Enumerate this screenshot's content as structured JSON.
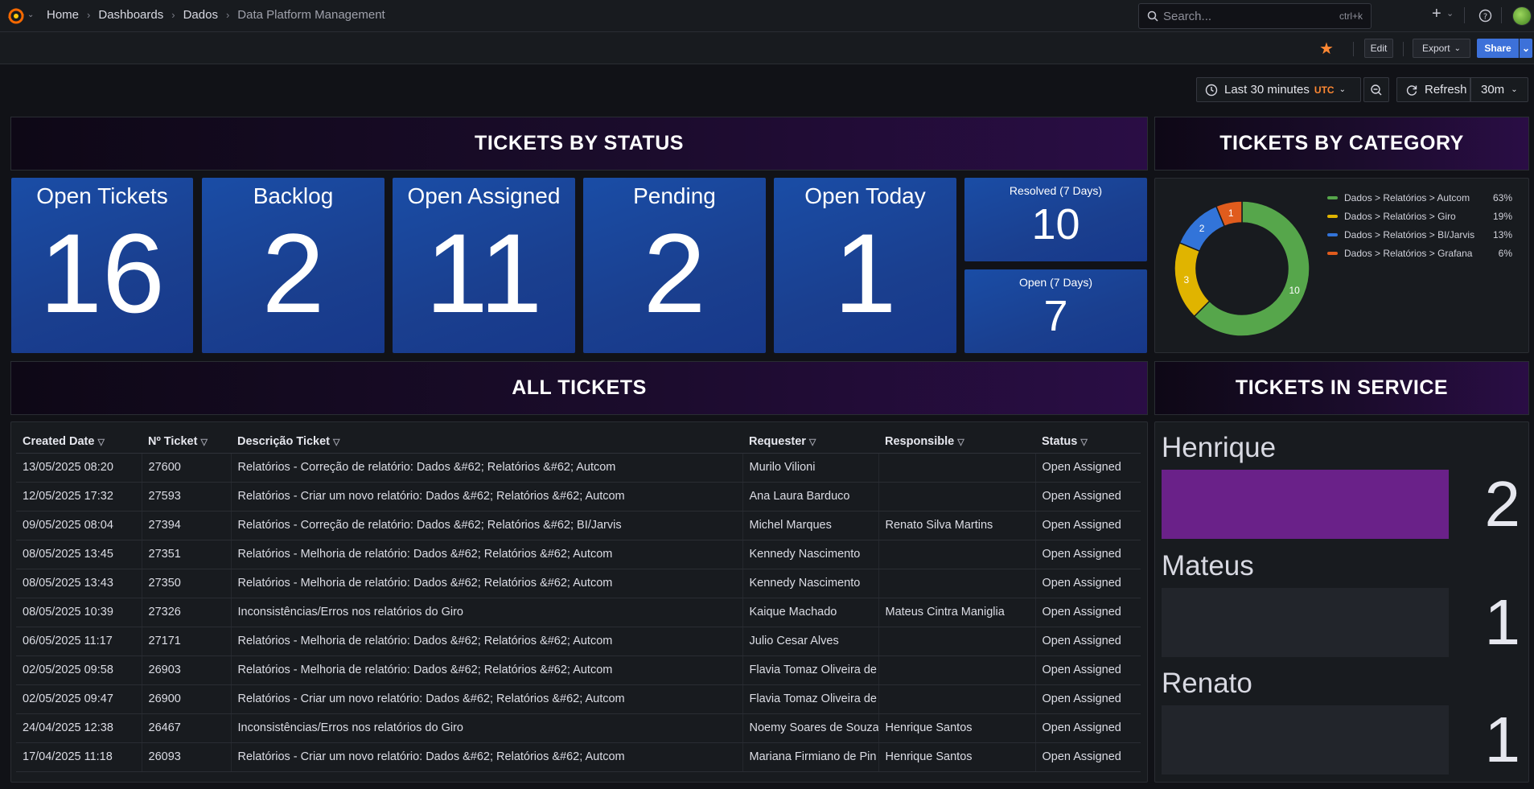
{
  "nav": {
    "breadcrumbs": [
      "Home",
      "Dashboards",
      "Dados",
      "Data Platform Management"
    ],
    "search_placeholder": "Search...",
    "search_shortcut": "ctrl+k"
  },
  "toolbar": {
    "edit_label": "Edit",
    "export_label": "Export",
    "share_label": "Share"
  },
  "time": {
    "range_label": "Last 30 minutes",
    "timezone": "UTC",
    "refresh_label": "Refresh",
    "refresh_interval": "30m"
  },
  "titles": {
    "status": "TICKETS BY STATUS",
    "category": "TICKETS BY CATEGORY",
    "all": "ALL TICKETS",
    "service": "TICKETS IN SERVICE"
  },
  "stats": [
    {
      "label": "Open Tickets",
      "value": "16"
    },
    {
      "label": "Backlog",
      "value": "2"
    },
    {
      "label": "Open Assigned",
      "value": "11"
    },
    {
      "label": "Pending",
      "value": "2"
    },
    {
      "label": "Open Today",
      "value": "1"
    },
    {
      "label": "Resolved (7 Days)",
      "value": "10"
    },
    {
      "label": "Open (7 Days)",
      "value": "7"
    }
  ],
  "category": {
    "legend": [
      {
        "name": "Dados > Relatórios > Autcom",
        "pct": "63%",
        "color": "#56a64b",
        "value": 10
      },
      {
        "name": "Dados > Relatórios > Giro",
        "pct": "19%",
        "color": "#e0b400",
        "value": 3
      },
      {
        "name": "Dados > Relatórios > BI/Jarvis",
        "pct": "13%",
        "color": "#3274d9",
        "value": 2
      },
      {
        "name": "Dados > Relatórios > Grafana",
        "pct": "6%",
        "color": "#e05c1d",
        "value": 1
      }
    ]
  },
  "table": {
    "headers": [
      "Created Date",
      "Nº Ticket",
      "Descrição Ticket",
      "Requester",
      "Responsible",
      "Status"
    ],
    "rows": [
      [
        "13/05/2025 08:20",
        "27600",
        "Relatórios - Correção de relatório: Dados &#62; Relatórios &#62; Autcom",
        "Murilo Vilioni",
        "",
        "Open Assigned"
      ],
      [
        "12/05/2025 17:32",
        "27593",
        "Relatórios - Criar um novo relatório: Dados &#62; Relatórios &#62; Autcom",
        "Ana Laura Barduco",
        "",
        "Open Assigned"
      ],
      [
        "09/05/2025 08:04",
        "27394",
        "Relatórios - Correção de relatório: Dados &#62; Relatórios &#62; BI/Jarvis",
        "Michel Marques",
        "Renato Silva Martins",
        "Open Assigned"
      ],
      [
        "08/05/2025 13:45",
        "27351",
        "Relatórios - Melhoria de relatório: Dados &#62; Relatórios &#62; Autcom",
        "Kennedy Nascimento",
        "",
        "Open Assigned"
      ],
      [
        "08/05/2025 13:43",
        "27350",
        "Relatórios - Melhoria de relatório: Dados &#62; Relatórios &#62; Autcom",
        "Kennedy Nascimento",
        "",
        "Open Assigned"
      ],
      [
        "08/05/2025 10:39",
        "27326",
        "Inconsistências/Erros nos relatórios do Giro",
        "Kaique Machado",
        "Mateus Cintra Maniglia",
        "Open Assigned"
      ],
      [
        "06/05/2025 11:17",
        "27171",
        "Relatórios - Melhoria de relatório: Dados &#62; Relatórios &#62; Autcom",
        "Julio Cesar Alves",
        "",
        "Open Assigned"
      ],
      [
        "02/05/2025 09:58",
        "26903",
        "Relatórios - Melhoria de relatório: Dados &#62; Relatórios &#62; Autcom",
        "Flavia Tomaz Oliveira de",
        "",
        "Open Assigned"
      ],
      [
        "02/05/2025 09:47",
        "26900",
        "Relatórios - Criar um novo relatório: Dados &#62; Relatórios &#62; Autcom",
        "Flavia Tomaz Oliveira de",
        "",
        "Open Assigned"
      ],
      [
        "24/04/2025 12:38",
        "26467",
        "Inconsistências/Erros nos relatórios do Giro",
        "Noemy Soares de Souza",
        "Henrique Santos",
        "Open Assigned"
      ],
      [
        "17/04/2025 11:18",
        "26093",
        "Relatórios - Criar um novo relatório: Dados &#62; Relatórios &#62; Autcom",
        "Mariana Firmiano de Pin",
        "Henrique Santos",
        "Open Assigned"
      ]
    ]
  },
  "service": [
    {
      "name": "Henrique",
      "value": "2",
      "fill": 1.0
    },
    {
      "name": "Mateus",
      "value": "1",
      "fill": 0.0
    },
    {
      "name": "Renato",
      "value": "1",
      "fill": 0.0
    }
  ],
  "colors": {
    "stat_blue": "#1a4da6",
    "title_purple": "#2a0d45",
    "bar_purple": "#6a2189",
    "star": "#ff8833",
    "share": "#3d71d9"
  }
}
